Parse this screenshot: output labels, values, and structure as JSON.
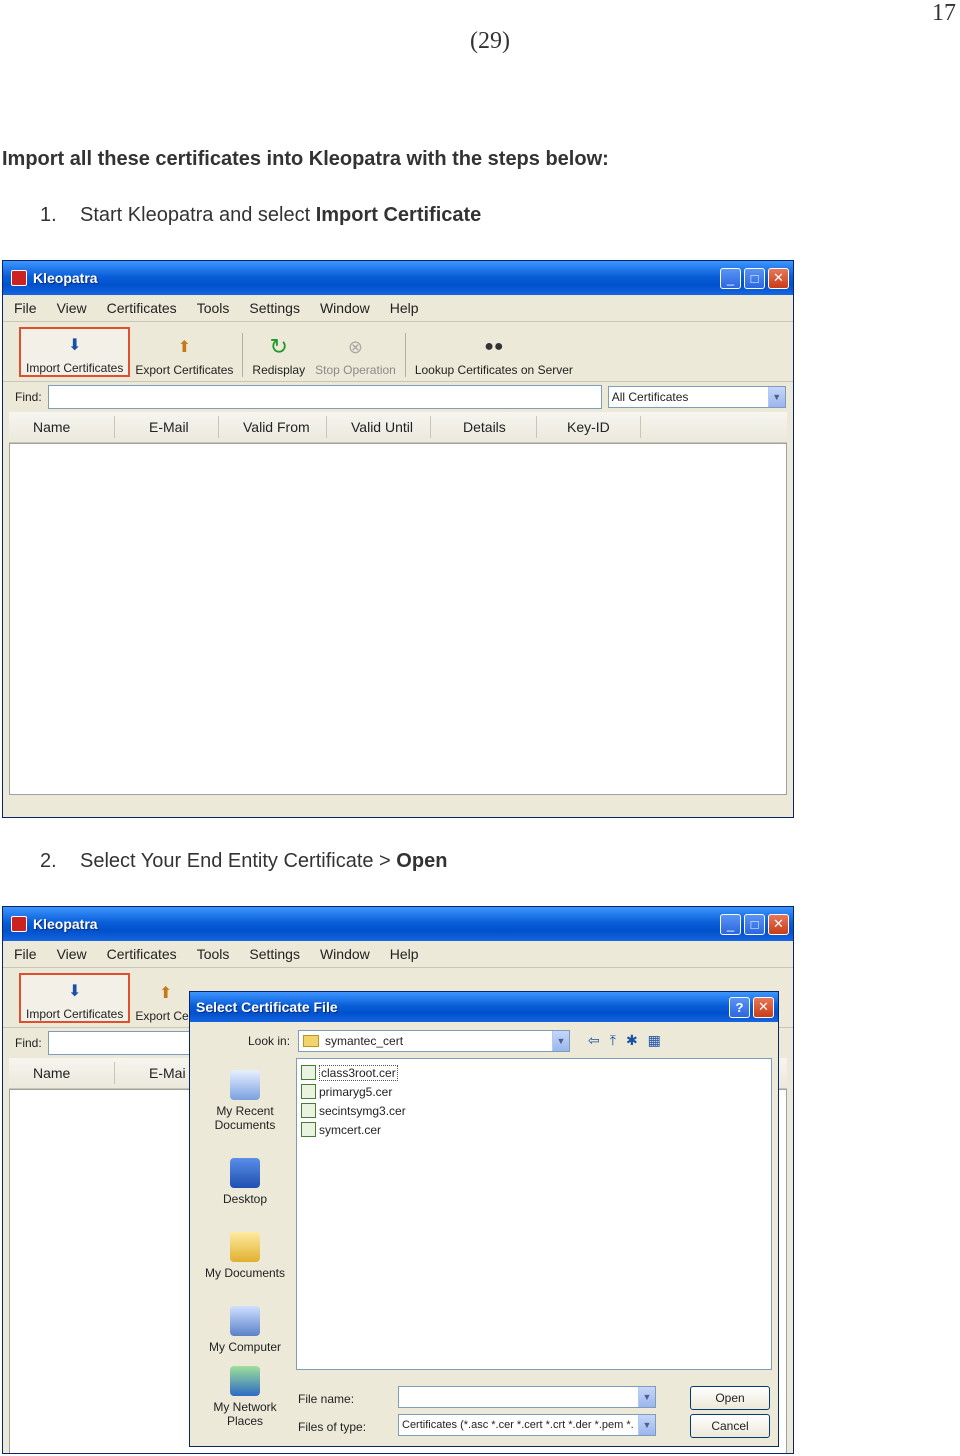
{
  "page": {
    "number": "17",
    "subnumber": "(29)"
  },
  "heading": "Import all these certificates into Kleopatra with the steps below:",
  "steps": [
    {
      "num": "1.",
      "text": "Start Kleopatra and select ",
      "bold": "Import Certificate"
    },
    {
      "num": "2.",
      "text": "Select Your End Entity Certificate > ",
      "bold": "Open"
    }
  ],
  "window": {
    "title": "Kleopatra",
    "menu": [
      "File",
      "View",
      "Certificates",
      "Tools",
      "Settings",
      "Window",
      "Help"
    ],
    "toolbar": {
      "import": "Import Certificates",
      "export": "Export Certificates",
      "redisplay": "Redisplay",
      "stop": "Stop Operation",
      "lookup": "Lookup Certificates on Server"
    },
    "find_label": "Find:",
    "filter": "All Certificates",
    "columns": [
      "Name",
      "E-Mail",
      "Valid From",
      "Valid Until",
      "Details",
      "Key-ID"
    ],
    "partial": {
      "export": "Export Cert",
      "email": "E-Mai"
    }
  },
  "dialog": {
    "title": "Select Certificate File",
    "look_in_label": "Look in:",
    "look_in_value": "symantec_cert",
    "places": [
      {
        "line1": "My Recent",
        "line2": "Documents"
      },
      {
        "line1": "Desktop",
        "line2": ""
      },
      {
        "line1": "My Documents",
        "line2": ""
      },
      {
        "line1": "My Computer",
        "line2": ""
      },
      {
        "line1": "My Network",
        "line2": "Places"
      }
    ],
    "files": [
      "class3root.cer",
      "primaryg5.cer",
      "secintsymg3.cer",
      "symcert.cer"
    ],
    "file_name_label": "File name:",
    "file_name_value": "",
    "file_type_label": "Files of type:",
    "file_type_value": "Certificates (*.asc *.cer *.cert *.crt *.der *.pem *.",
    "open": "Open",
    "cancel": "Cancel"
  },
  "colors": {
    "title_blue": "#0a5fd8",
    "xp_face": "#ece9d8",
    "highlight": "#e05030"
  }
}
